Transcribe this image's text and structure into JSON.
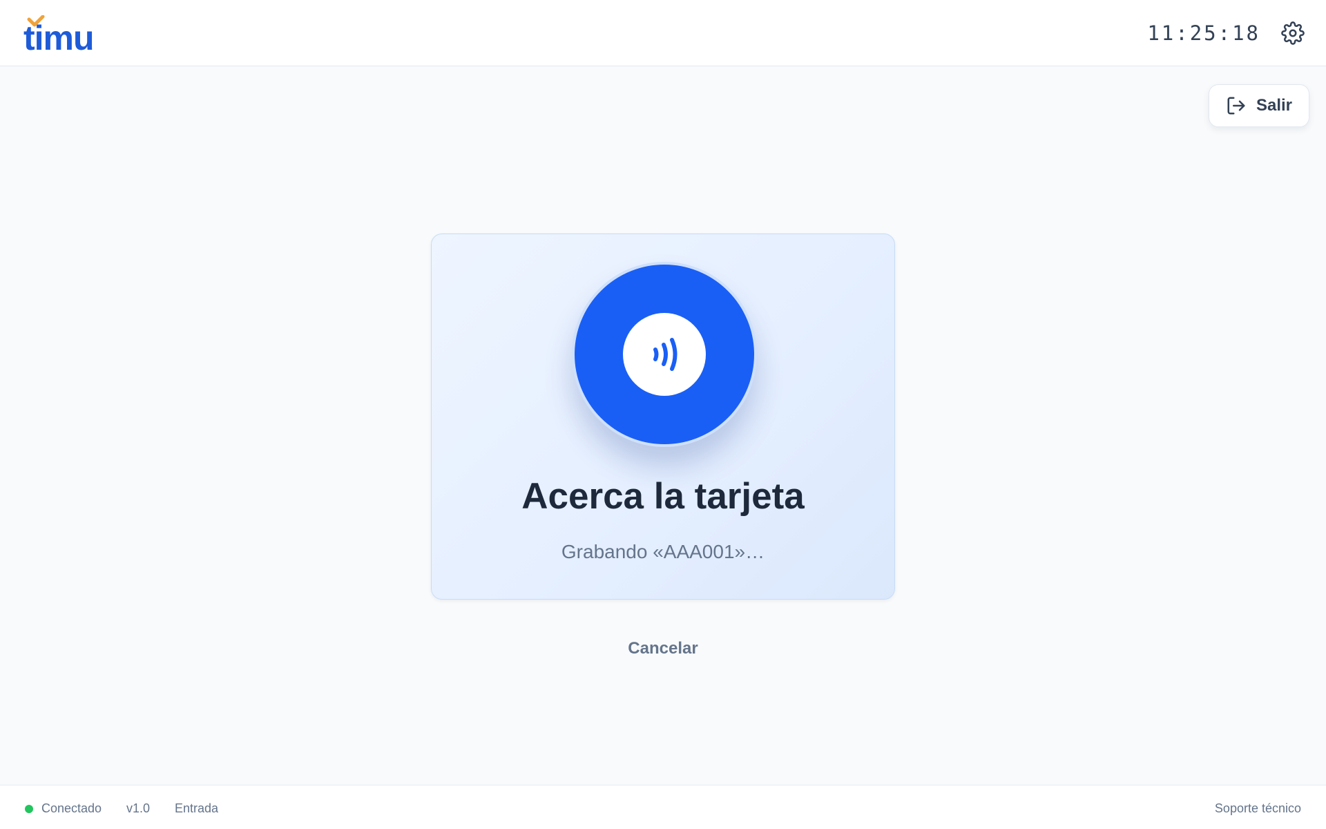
{
  "header": {
    "logo_text": "timu",
    "clock": "11:25:18",
    "settings_icon": "gear-icon"
  },
  "exit_button": {
    "label": "Salir",
    "icon": "logout-icon"
  },
  "card": {
    "icon": "nfc-contactless-icon",
    "title": "Acerca la tarjeta",
    "subtitle": "Grabando «AAA001»…"
  },
  "cancel_label": "Cancelar",
  "footer": {
    "status": "Conectado",
    "version": "v1.0",
    "mode": "Entrada",
    "support": "Soporte técnico"
  },
  "colors": {
    "brand_blue": "#1a5ff5",
    "logo_accent": "#f0a23a",
    "status_connected": "#22c55e"
  }
}
